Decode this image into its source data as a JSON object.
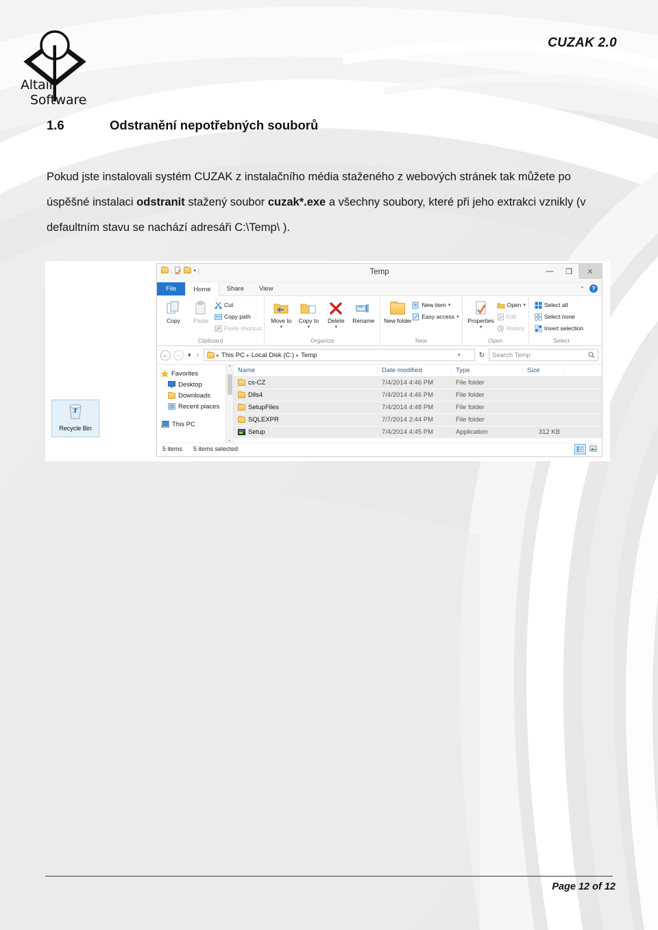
{
  "header": {
    "product": "CUZAK 2.0"
  },
  "logo": {
    "line1": "Altair",
    "line2": "Software"
  },
  "section": {
    "number": "1.6",
    "title": "Odstranění nepotřebných souborů"
  },
  "paragraph": {
    "part1": "Pokud jste instalovali systém CUZAK z instalačního média staženého z webových stránek tak můžete po úspěšné instalaci ",
    "bold1": "odstranit",
    "part2": " stažený soubor ",
    "bold2": "cuzak*.exe",
    "part3": " a všechny soubory, které při jeho extrakci vznikly (v defaultním stavu se nachází adresáři C:\\Temp\\ )."
  },
  "screenshot": {
    "desktop": {
      "recycle_bin_label": "Recycle Bin",
      "recycle_bin_icon": "recycle-bin-icon"
    },
    "window": {
      "title": "Temp",
      "quick_access_icons": [
        "folder-icon",
        "properties-icon",
        "new-folder-icon",
        "chevron-down-icon"
      ],
      "window_buttons": {
        "minimize": "—",
        "maximize": "❐",
        "close": "✕"
      },
      "ribbon_collapse_icon": "chevron-up-icon",
      "help_icon": "help-icon",
      "tabs": [
        {
          "label": "File",
          "state": "file"
        },
        {
          "label": "Home",
          "state": "active"
        },
        {
          "label": "Share",
          "state": "normal"
        },
        {
          "label": "View",
          "state": "normal"
        }
      ],
      "ribbon_groups": [
        {
          "label": "Clipboard",
          "big_buttons": [
            {
              "label": "Copy",
              "icon": "copy-icon",
              "disabled": false
            },
            {
              "label": "Paste",
              "icon": "paste-icon",
              "disabled": true
            }
          ],
          "small_buttons": [
            {
              "label": "Cut",
              "icon": "scissors-icon",
              "disabled": false
            },
            {
              "label": "Copy path",
              "icon": "copy-path-icon",
              "disabled": false
            },
            {
              "label": "Paste shortcut",
              "icon": "paste-shortcut-icon",
              "disabled": true
            }
          ]
        },
        {
          "label": "Organize",
          "big_buttons": [
            {
              "label": "Move to",
              "icon": "move-to-icon",
              "caret": true
            },
            {
              "label": "Copy to",
              "icon": "copy-to-icon",
              "caret": true
            },
            {
              "label": "Delete",
              "icon": "delete-icon",
              "caret": true
            },
            {
              "label": "Rename",
              "icon": "rename-icon",
              "caret": false
            }
          ],
          "small_buttons": []
        },
        {
          "label": "New",
          "big_buttons": [
            {
              "label": "New folder",
              "icon": "new-folder-icon",
              "disabled": false
            }
          ],
          "small_buttons": [
            {
              "label": "New item",
              "icon": "new-item-icon",
              "caret": true
            },
            {
              "label": "Easy access",
              "icon": "easy-access-icon",
              "caret": true
            }
          ]
        },
        {
          "label": "Open",
          "big_buttons": [
            {
              "label": "Properties",
              "icon": "properties-icon",
              "caret": true
            }
          ],
          "small_buttons": [
            {
              "label": "Open",
              "icon": "open-icon",
              "caret": true
            },
            {
              "label": "Edit",
              "icon": "edit-icon",
              "disabled": true
            },
            {
              "label": "History",
              "icon": "history-icon",
              "disabled": true
            }
          ]
        },
        {
          "label": "Select",
          "big_buttons": [],
          "small_buttons": [
            {
              "label": "Select all",
              "icon": "select-all-icon"
            },
            {
              "label": "Select none",
              "icon": "select-none-icon"
            },
            {
              "label": "Invert selection",
              "icon": "invert-selection-icon"
            }
          ]
        }
      ],
      "address_bar": {
        "back_icon": "back-arrow-icon",
        "forward_icon": "forward-arrow-icon",
        "recent_icon": "chevron-down-icon",
        "up_icon": "up-arrow-icon",
        "path_icon": "folder-icon",
        "breadcrumbs": [
          "This PC",
          "Local Disk (C:)",
          "Temp"
        ],
        "dropdown_icon": "chevron-down-icon",
        "refresh_icon": "refresh-icon",
        "search_placeholder": "Search Temp",
        "search_icon": "search-icon"
      },
      "nav_pane": [
        {
          "label": "Favorites",
          "icon": "star-icon",
          "level": 0
        },
        {
          "label": "Desktop",
          "icon": "desktop-icon",
          "level": 1
        },
        {
          "label": "Downloads",
          "icon": "downloads-icon",
          "level": 1
        },
        {
          "label": "Recent places",
          "icon": "recent-places-icon",
          "level": 1
        },
        {
          "label": "This PC",
          "icon": "this-pc-icon",
          "level": 0,
          "spaced": true
        }
      ],
      "columns": [
        "Name",
        "Date modified",
        "Type",
        "Size"
      ],
      "rows": [
        {
          "name": "cs-CZ",
          "date": "7/4/2014 4:46 PM",
          "type": "File folder",
          "size": "",
          "icon": "folder-icon"
        },
        {
          "name": "Dlls4",
          "date": "7/4/2014 4:46 PM",
          "type": "File folder",
          "size": "",
          "icon": "folder-icon"
        },
        {
          "name": "SetupFiles",
          "date": "7/4/2014 4:48 PM",
          "type": "File folder",
          "size": "",
          "icon": "folder-icon"
        },
        {
          "name": "SQLEXPR",
          "date": "7/7/2014 2:44 PM",
          "type": "File folder",
          "size": "",
          "icon": "folder-icon"
        },
        {
          "name": "Setup",
          "date": "7/4/2014 4:45 PM",
          "type": "Application",
          "size": "312 KB",
          "icon": "application-icon"
        }
      ],
      "status": {
        "item_count": "5 items",
        "selection": "5 items selected"
      },
      "view_toggles": [
        {
          "icon": "details-view-icon",
          "active": true
        },
        {
          "icon": "large-icons-view-icon",
          "active": false
        }
      ]
    }
  },
  "footer": {
    "page_label": "Page 12 of 12"
  },
  "colors": {
    "accent_blue": "#1f77d0",
    "page_background": "#ededed",
    "text": "#151515"
  }
}
